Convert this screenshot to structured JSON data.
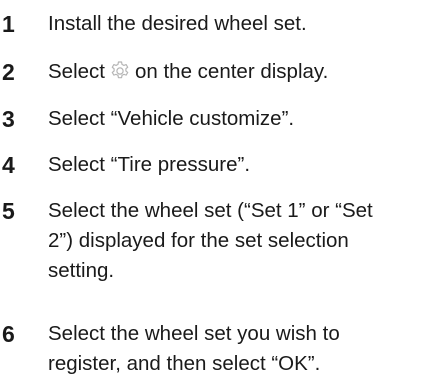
{
  "accent_color": "#1a1a1a",
  "icon_color": "#b5b5b5",
  "steps": [
    {
      "number": "1",
      "lines": [
        "Install the desired wheel set."
      ]
    },
    {
      "number": "2",
      "before_icon": "Select",
      "icon": "gear-icon",
      "after_icon": "on the center display."
    },
    {
      "number": "3",
      "lines": [
        "Select “Vehicle customize”."
      ]
    },
    {
      "number": "4",
      "lines": [
        "Select “Tire pressure”."
      ]
    },
    {
      "number": "5",
      "lines": [
        "Select the wheel set (“Set 1” or “Set",
        "2”) displayed for the set selection",
        "setting."
      ]
    },
    {
      "number": "6",
      "lines": [
        "Select the wheel set you wish to",
        "register, and then select “OK”."
      ]
    }
  ]
}
